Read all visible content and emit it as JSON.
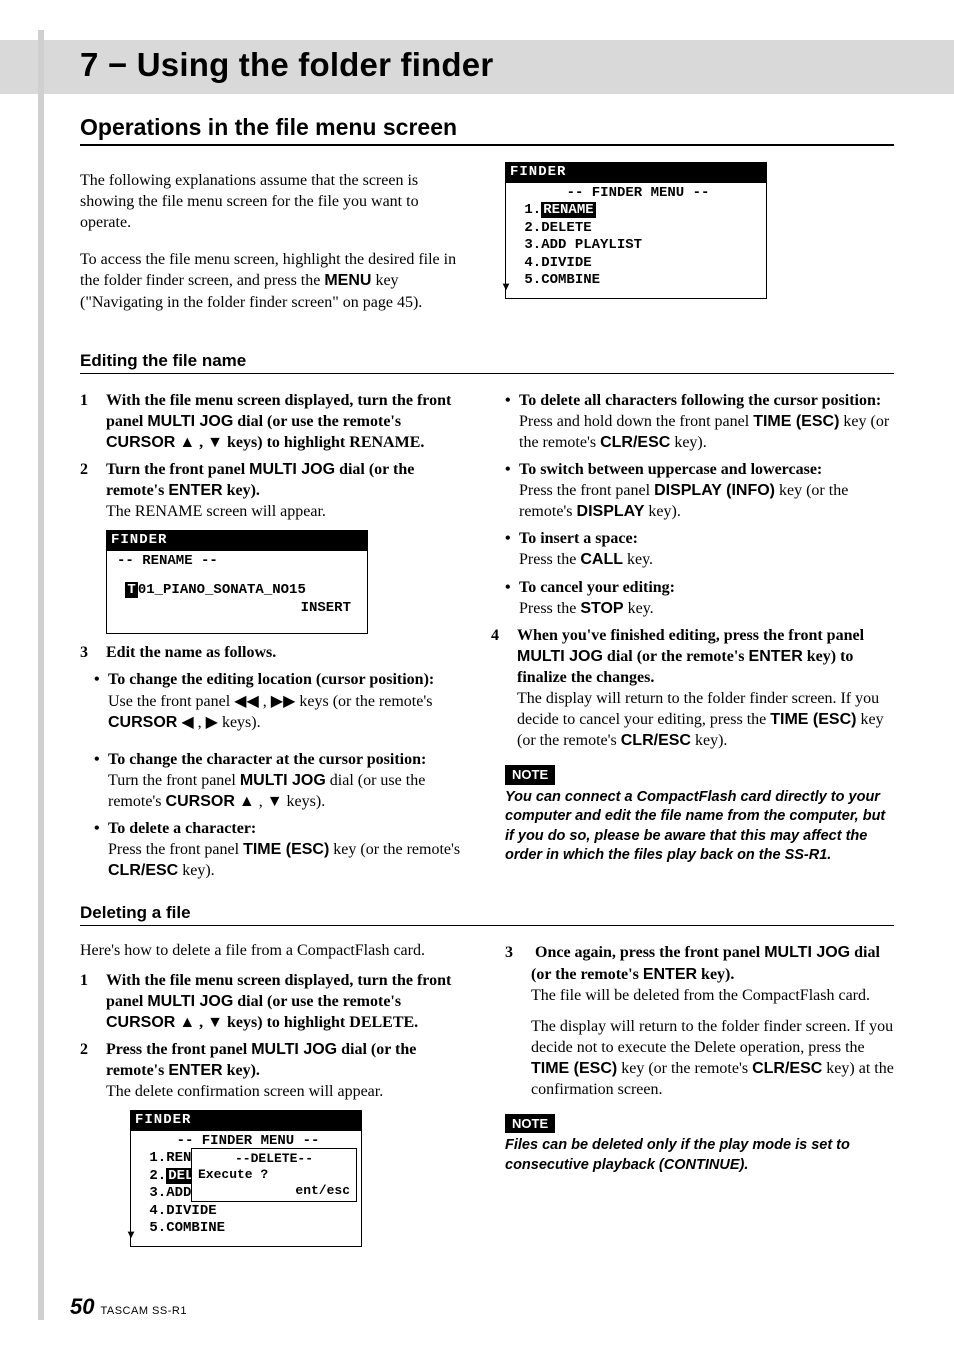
{
  "banner_title": "7 − Using the folder finder",
  "section_title": "Operations in the file menu screen",
  "intro_para1": "The following explanations assume that the screen is showing the file menu screen for the file you want to operate.",
  "intro_para2_a": "To access the file menu screen, highlight the desired file in the folder finder screen, and press the ",
  "intro_para2_key": "MENU",
  "intro_para2_b": " key (\"Navigating in the folder finder screen\" on page 45).",
  "finder_screen1": {
    "header": "FINDER",
    "title": "-- FINDER MENU --",
    "items": [
      "1.",
      "RENAME",
      "2.DELETE",
      "3.ADD PLAYLIST",
      "4.DIVIDE",
      "5.COMBINE"
    ]
  },
  "edit_heading": "Editing the file name",
  "edit_step1_a": "With the file menu screen displayed, turn the front panel ",
  "edit_step1_k1": "MULTI JOG",
  "edit_step1_b": " dial (or use the remote's ",
  "edit_step1_k2": "CURSOR",
  "edit_step1_c": " ▲ ,  ▼ keys) to highlight RENAME.",
  "edit_step2_a": "Turn the front panel ",
  "edit_step2_k1": "MULTI JOG",
  "edit_step2_b": " dial (or the remote's ",
  "edit_step2_k2": "ENTER",
  "edit_step2_c": " key).",
  "edit_step2_follow": "The RENAME screen will appear.",
  "rename_screen": {
    "header": "FINDER",
    "title": "-- RENAME --",
    "filename_prefix": "T",
    "filename": "01_PIANO_SONATA_NO15",
    "insert": "INSERT"
  },
  "edit_step3": "Edit the name as follows.",
  "b1_lead": "To change the editing location (cursor position):",
  "b1_follow_a": "Use the front panel ◀◀ ,  ▶▶ keys (or the remote's ",
  "b1_follow_k": "CURSOR",
  "b1_follow_b": " ◀ ,  ▶ keys).",
  "b2_lead": "To change the character at the cursor position:",
  "b2_follow_a": "Turn the front panel ",
  "b2_follow_k1": "MULTI JOG",
  "b2_follow_b": " dial (or use the remote's ",
  "b2_follow_k2": "CURSOR",
  "b2_follow_c": " ▲ ,  ▼ keys).",
  "b3_lead": "To delete a character:",
  "b3_follow_a": "Press the front panel ",
  "b3_follow_k1": "TIME (ESC)",
  "b3_follow_b": " key (or the remote's ",
  "b3_follow_k2": "CLR/ESC",
  "b3_follow_c": " key).",
  "b4_lead": "To delete all characters following the cursor position:",
  "b4_follow_a": "Press and hold down the front panel ",
  "b4_follow_k1": "TIME (ESC)",
  "b4_follow_b": " key (or the remote's ",
  "b4_follow_k2": "CLR/ESC",
  "b4_follow_c": " key).",
  "b5_lead": "To switch between uppercase and lowercase:",
  "b5_follow_a": "Press the front panel ",
  "b5_follow_k1": "DISPLAY (INFO)",
  "b5_follow_b": " key (or the remote's ",
  "b5_follow_k2": "DISPLAY",
  "b5_follow_c": " key).",
  "b6_lead": "To insert a space:",
  "b6_follow_a": "Press the ",
  "b6_follow_k": "CALL",
  "b6_follow_b": " key.",
  "b7_lead": "To cancel your editing:",
  "b7_follow_a": "Press the ",
  "b7_follow_k": "STOP",
  "b7_follow_b": " key.",
  "edit_step4_a": "When you've finished editing, press the front panel ",
  "edit_step4_k1": "MULTI JOG",
  "edit_step4_b": " dial (or the remote's ",
  "edit_step4_k2": "ENTER",
  "edit_step4_c": " key) to finalize the changes.",
  "edit_step4_follow_a": "The display will return to the folder finder screen. If you decide to cancel your editing, press the ",
  "edit_step4_follow_k1": "TIME (ESC)",
  "edit_step4_follow_b": " key (or the remote's ",
  "edit_step4_follow_k2": "CLR/ESC",
  "edit_step4_follow_c": " key).",
  "note_label": "NOTE",
  "note1": "You can connect a CompactFlash card directly to your computer and edit the file name from the computer, but if you do so, please be aware that this may affect the order in which the files play back on the SS-R1.",
  "del_heading": "Deleting a file",
  "del_intro": "Here's how to delete a file from a CompactFlash card.",
  "del_step1_a": "With the file menu screen displayed, turn the front panel ",
  "del_step1_k1": "MULTI JOG",
  "del_step1_b": " dial (or use the remote's ",
  "del_step1_k2": "CURSOR",
  "del_step1_c": " ▲ ,  ▼ keys) to highlight DELETE.",
  "del_step2_a": "Press the front panel ",
  "del_step2_k1": "MULTI JOG",
  "del_step2_b": " dial (or the remote's ",
  "del_step2_k2": "ENTER",
  "del_step2_c": " key).",
  "del_step2_follow": "The delete confirmation screen will appear.",
  "del_screen": {
    "header": "FINDER",
    "title": "-- FINDER MENU --",
    "items_left": [
      "1.REN",
      "2.",
      "DEL",
      "3.ADD",
      "4.DIVIDE",
      "5.COMBINE"
    ],
    "overlay": [
      "--DELETE--",
      "Execute ?",
      "ent/esc"
    ]
  },
  "del_step3_a": "Once again, press the front panel ",
  "del_step3_k1": "MULTI JOG",
  "del_step3_b": " dial (or the remote's ",
  "del_step3_k2": "ENTER",
  "del_step3_c": " key).",
  "del_step3_follow": "The file will be deleted from the CompactFlash card.",
  "del_extra_a": "The display will return to the folder finder screen. If you decide not to execute the Delete operation, press the ",
  "del_extra_k1": "TIME (ESC)",
  "del_extra_b": " key (or the remote's ",
  "del_extra_k2": "CLR/ESC",
  "del_extra_c": " key) at the confirmation screen.",
  "note2": "Files can be deleted only if the play mode is set to consecutive playback (CONTINUE).",
  "page_number": "50",
  "footer_text": "TASCAM  SS-R1"
}
